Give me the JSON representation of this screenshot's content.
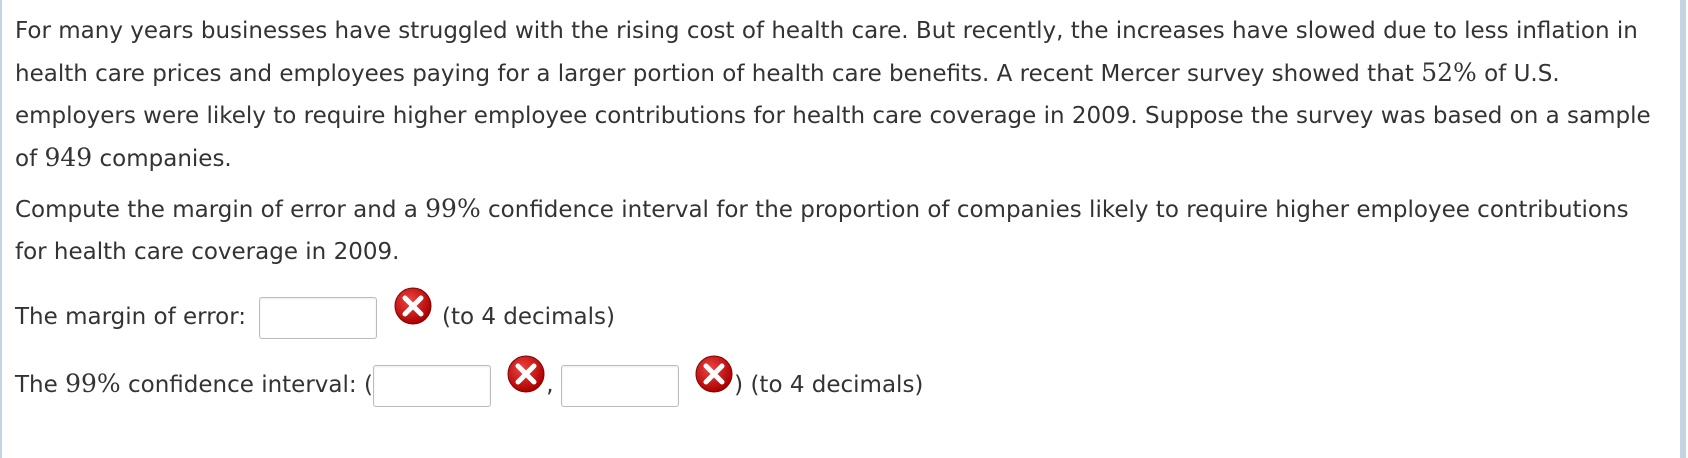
{
  "problem": {
    "p1_before_pct": "For many years businesses have struggled with the rising cost of health care. But recently, the increases have slowed due to less inflation in health care prices and employees paying for a larger portion of health care benefits. A recent Mercer survey showed that ",
    "pct52": "52%",
    "p1_mid": " of U.S. employers were likely to require higher employee contributions for health care coverage in 2009. Suppose the survey was based on a sample of ",
    "n949": "949",
    "p1_after": " companies.",
    "p2_before": "Compute the margin of error and a ",
    "pct99": "99%",
    "p2_after": " confidence interval for the proportion of companies likely to require higher employee contributions for health care coverage in 2009."
  },
  "margin": {
    "label": "The margin of error:",
    "value": "",
    "hint": "(to 4 decimals)"
  },
  "interval": {
    "label_before": "The ",
    "pct": "99%",
    "label_after": " confidence interval: (",
    "lower": "",
    "comma": ",",
    "upper": "",
    "closing": ") (to 4 decimals)"
  },
  "icons": {
    "incorrect": "incorrect-x-icon",
    "incorrect_color": "#cc1111"
  }
}
